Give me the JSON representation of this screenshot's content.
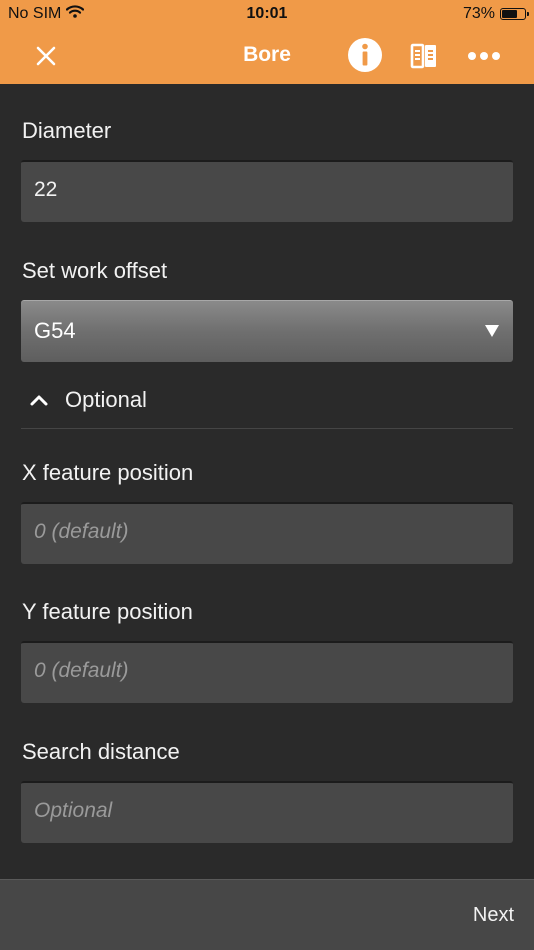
{
  "status_bar": {
    "carrier": "No SIM",
    "time": "10:01",
    "battery_percent": "73%",
    "battery_level": 0.73,
    "wifi_icon": "wifi-icon"
  },
  "nav": {
    "title": "Bore",
    "close_icon": "close-icon",
    "info_icon": "info-icon",
    "book_icon": "book-icon",
    "more_icon": "more-icon"
  },
  "form": {
    "diameter": {
      "label": "Diameter",
      "value": "22"
    },
    "work_offset": {
      "label": "Set work offset",
      "selected": "G54"
    },
    "optional_toggle": {
      "label": "Optional",
      "expanded": true
    },
    "x_position": {
      "label": "X feature position",
      "placeholder": "0 (default)"
    },
    "y_position": {
      "label": "Y feature position",
      "placeholder": "0 (default)"
    },
    "search_distance": {
      "label": "Search distance",
      "placeholder": "Optional"
    }
  },
  "footer": {
    "next_label": "Next"
  },
  "colors": {
    "accent": "#f09a48",
    "background": "#2a2a2a",
    "field": "#484848",
    "bottom_bar": "#474747"
  }
}
